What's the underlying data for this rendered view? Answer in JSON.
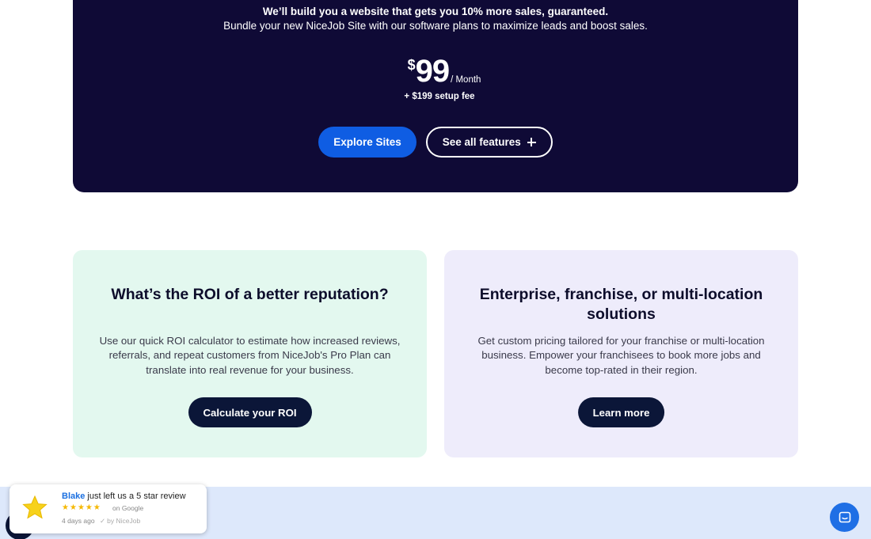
{
  "hero": {
    "headline": "We’ll build you a website that gets you 10% more sales, guaranteed.",
    "subheadline": "Bundle your new NiceJob Site with our software plans to maximize leads and boost sales.",
    "price_currency": "$",
    "price_amount": "99",
    "price_period": "/ Month",
    "setup_fee": "+ $199 setup fee",
    "explore_button": "Explore Sites",
    "features_button": "See all features"
  },
  "cards": {
    "roi": {
      "title": "What’s the ROI of a better reputation?",
      "text": "Use our quick ROI calculator to estimate how increased reviews, referrals, and repeat customers from NiceJob's Pro Plan can translate into real revenue for your business.",
      "button": "Calculate your ROI"
    },
    "enterprise": {
      "title": "Enterprise, franchise, or multi-location solutions",
      "text": "Get custom pricing tailored for your franchise or multi-location business. Empower your franchisees to book more jobs and become top-rated in their region.",
      "button": "Learn more"
    }
  },
  "review_popup": {
    "reviewer": "Blake",
    "message": " just left us a 5 star review",
    "rating": 5,
    "source": "on Google",
    "time": "4 days ago",
    "by": "by NiceJob"
  },
  "colors": {
    "hero_bg": "#0f0a36",
    "primary_blue": "#0f5de3",
    "roi_card_bg": "#e3f8ef",
    "enterprise_card_bg": "#eeecfb",
    "dark_button": "#0b1638",
    "bottom_band": "#dde8fb",
    "star_yellow": "#f5b800"
  },
  "icons": {
    "features_button_icon": "plus-icon",
    "review_icon": "star-icon",
    "chat_icon": "chat-bubble-icon"
  }
}
